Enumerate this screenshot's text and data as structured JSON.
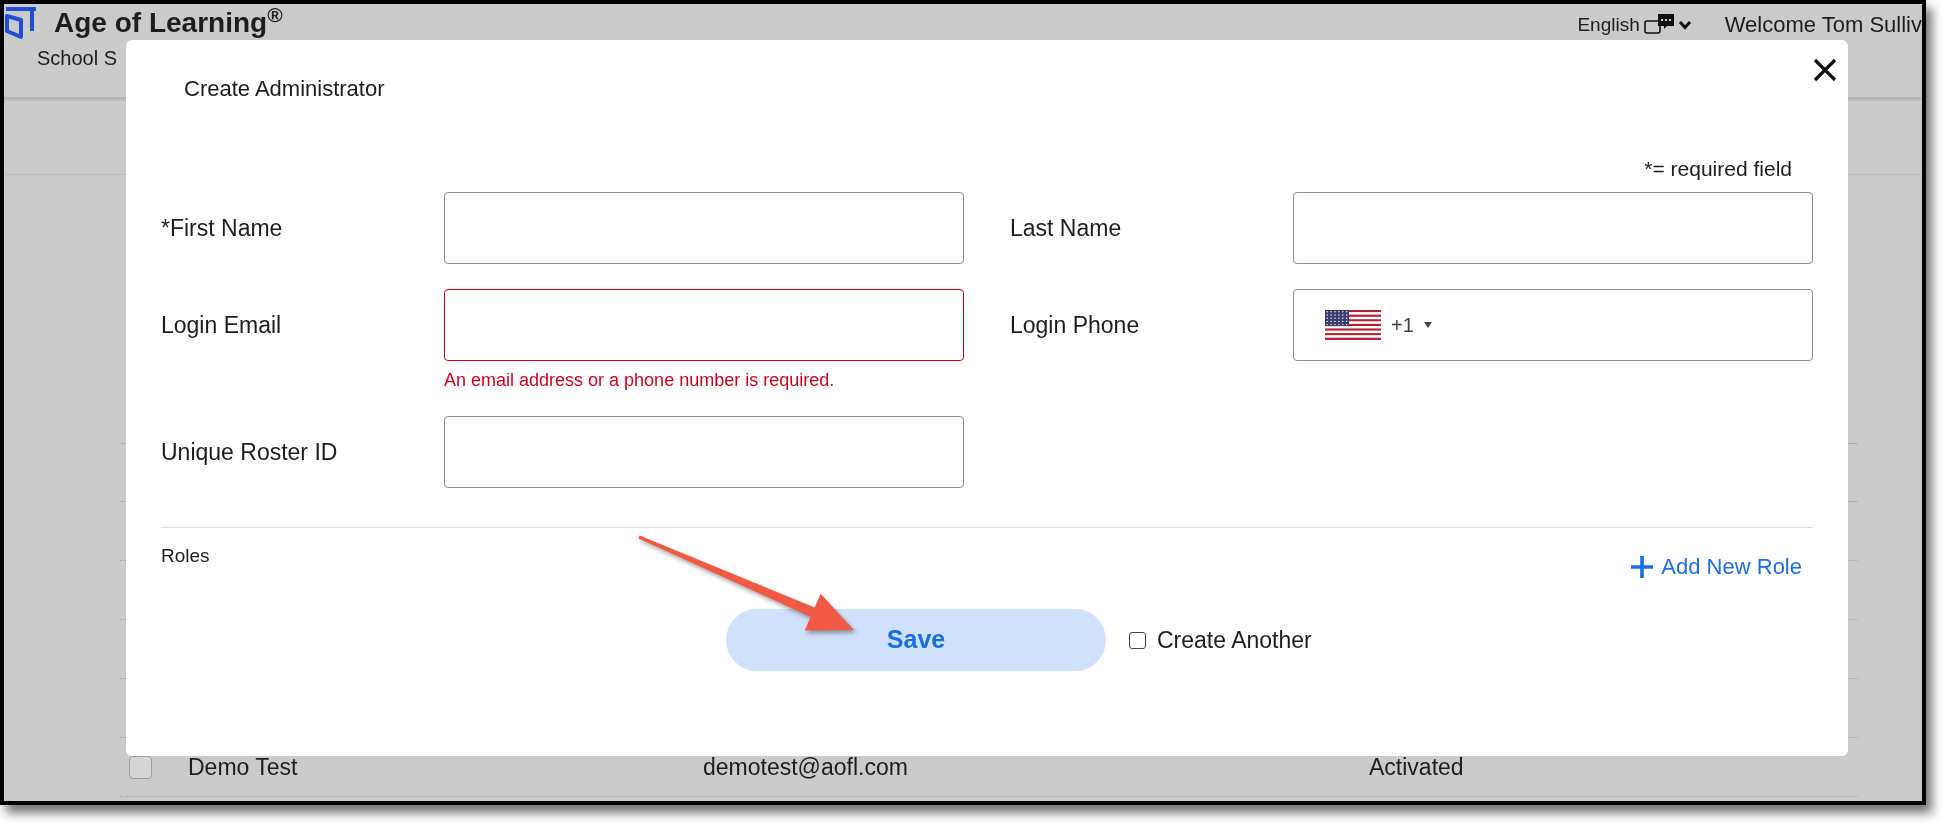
{
  "page": {
    "header": {
      "logo_title": "Age of Learning$^{®}$",
      "logo_subtitle": "School S",
      "language": "English",
      "welcome": "Welcome Tom Sulliv"
    },
    "table": {
      "rows": [
        {
          "checked": false,
          "name": "Demo Test",
          "email": "demotest@aofl.com",
          "status": "Activated"
        }
      ]
    }
  },
  "dialog": {
    "title": "Create Administrator",
    "required_note": "*= required field",
    "fields": [
      {
        "label": "*First Name",
        "kind": "text",
        "invalid": false
      },
      {
        "label": "Last Name",
        "kind": "text",
        "invalid": false
      },
      {
        "label": "Login Email",
        "kind": "text",
        "invalid": true,
        "error": "An email address or a phone number is required."
      },
      {
        "label": "Login Phone",
        "kind": "phone",
        "invalid": false,
        "dial_code": "+1"
      },
      {
        "label": "Unique Roster ID",
        "kind": "text",
        "invalid": false
      }
    ],
    "roles": {
      "label": "Roles",
      "add_button": "Add New Role"
    },
    "save_button": "Save",
    "create_another": {
      "label": "Create Another",
      "checked": false
    }
  }
}
